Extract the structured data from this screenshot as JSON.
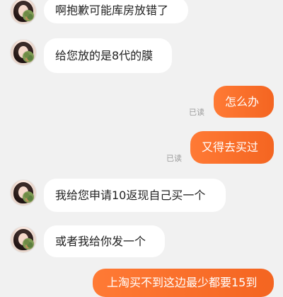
{
  "chat": {
    "messages": [
      {
        "side": "incoming",
        "text": "啊抱歉可能库房放错了"
      },
      {
        "side": "incoming",
        "text": "给您放的是8代的膜"
      },
      {
        "side": "outgoing",
        "text": "怎么办",
        "status": "已读"
      },
      {
        "side": "outgoing",
        "text": "又得去买过",
        "status": "已读"
      },
      {
        "side": "incoming",
        "text": "我给您申请10返现自己买一个"
      },
      {
        "side": "incoming",
        "text": "或者我给你发一个"
      },
      {
        "side": "outgoing",
        "text": "上淘买不到这边最少都要15到"
      }
    ]
  },
  "colors": {
    "background": "#f1f1f1",
    "incoming_bubble": "#ffffff",
    "outgoing_bubble": "#f46521",
    "read_text": "#9b9b9b"
  }
}
